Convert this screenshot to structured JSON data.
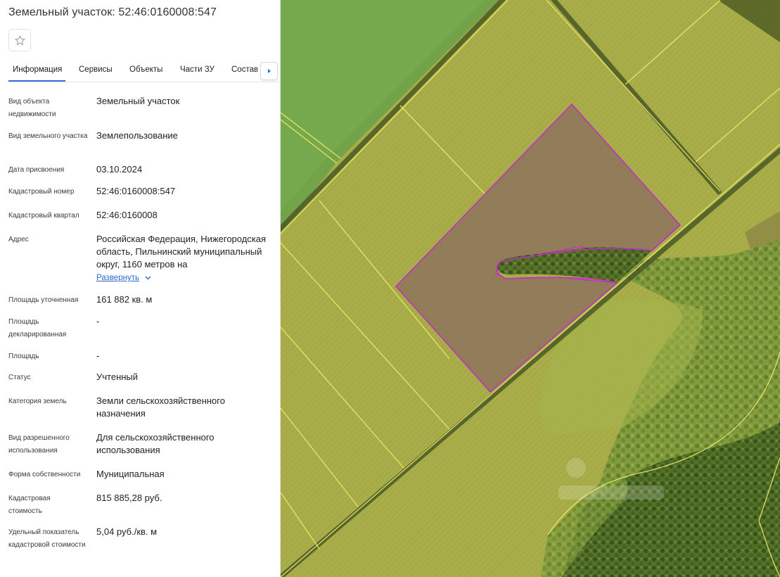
{
  "header": {
    "title": "Земельный участок: 52:46:0160008:547"
  },
  "tabs": [
    {
      "label": "Информация",
      "active": true
    },
    {
      "label": "Сервисы",
      "active": false
    },
    {
      "label": "Объекты",
      "active": false
    },
    {
      "label": "Части ЗУ",
      "active": false
    },
    {
      "label": "Состав",
      "active": false
    }
  ],
  "fields": {
    "object_type": {
      "label": "Вид объекта недвижимости",
      "value": "Земельный участок"
    },
    "parcel_type": {
      "label": "Вид земельного участка",
      "value": "Землепользование"
    },
    "assigned_date": {
      "label": "Дата присвоения",
      "value": "03.10.2024"
    },
    "cadastral_number": {
      "label": "Кадастровый номер",
      "value": "52:46:0160008:547"
    },
    "cadastral_block": {
      "label": "Кадастровый квартал",
      "value": "52:46:0160008"
    },
    "address": {
      "label": "Адрес",
      "value": "Российская Федерация, Нижегородская область, Пильнинский муниципальный округ, 1160 метров на"
    },
    "area_specified": {
      "label": "Площадь уточненная",
      "value": "161 882 кв. м"
    },
    "area_declared": {
      "label": "Площадь декларированная",
      "value": "-"
    },
    "area": {
      "label": "Площадь",
      "value": "-"
    },
    "status": {
      "label": "Статус",
      "value": "Учтенный"
    },
    "land_category": {
      "label": "Категория земель",
      "value": "Земли сельскохозяйственного назначения"
    },
    "permitted_use": {
      "label": "Вид разрешенного использования",
      "value": "Для сельскохозяйственного использования"
    },
    "ownership": {
      "label": "Форма собственности",
      "value": "Муниципальная"
    },
    "cadastral_value": {
      "label": "Кадастровая стоимость",
      "value": "815 885,28 руб."
    },
    "specific_value": {
      "label": "Удельный показатель кадастровой стоимости",
      "value": "5,04 руб./кв. м"
    }
  },
  "address_expand_label": "Развернуть",
  "icons": {
    "favorite": "star-outline-icon",
    "tabs_next": "caret-right-icon",
    "expand": "chevron-down-icon"
  },
  "colors": {
    "accent": "#2f6fd6",
    "link": "#2d6ac8",
    "parcel_outline": "#c22fc2",
    "boundary_lines": "#f2ea6a"
  }
}
